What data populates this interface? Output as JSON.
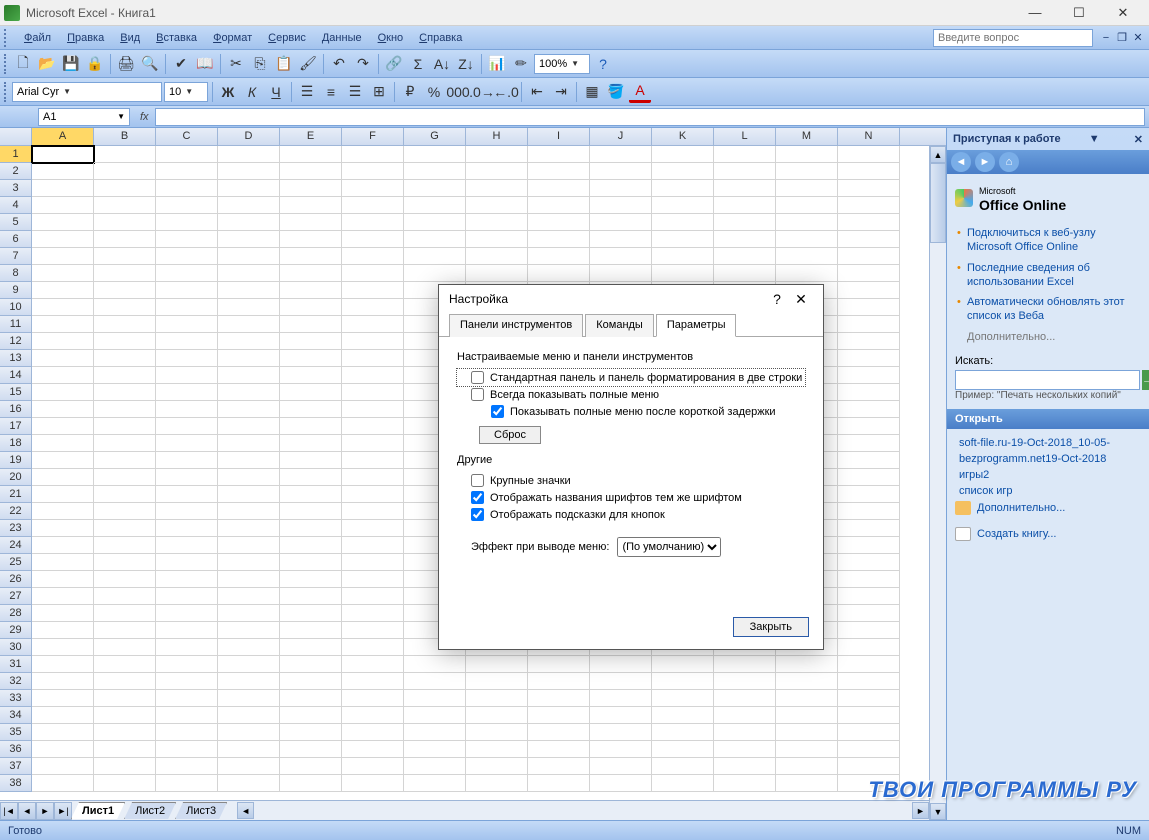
{
  "window": {
    "title": "Microsoft Excel - Книга1"
  },
  "menu": {
    "items": [
      "Файл",
      "Правка",
      "Вид",
      "Вставка",
      "Формат",
      "Сервис",
      "Данные",
      "Окно",
      "Справка"
    ],
    "ask_placeholder": "Введите вопрос"
  },
  "toolbar2": {
    "font": "Arial Cyr",
    "size": "10",
    "zoom": "100%"
  },
  "namebox": "A1",
  "columns": [
    "A",
    "B",
    "C",
    "D",
    "E",
    "F",
    "G",
    "H",
    "I",
    "J",
    "K",
    "L",
    "M",
    "N"
  ],
  "rowcount": 38,
  "active_cell": {
    "row": 1,
    "col": 0
  },
  "sheets": {
    "tabs": [
      "Лист1",
      "Лист2",
      "Лист3"
    ],
    "active": 0
  },
  "taskpane": {
    "title": "Приступая к работе",
    "office_label_1": "Microsoft",
    "office_label_2": "Office Online",
    "links": [
      "Подключиться к веб-узлу Microsoft Office Online",
      "Последние сведения об использовании Excel",
      "Автоматически обновлять этот список из Веба"
    ],
    "more": "Дополнительно...",
    "search_label": "Искать:",
    "example": "Пример: \"Печать нескольких копий\"",
    "open_header": "Открыть",
    "files": [
      "soft-file.ru-19-Oct-2018_10-05-",
      "bezprogramm.net19-Oct-2018",
      "игры2",
      "список игр"
    ],
    "more_files": "Дополнительно...",
    "create": "Создать книгу..."
  },
  "dialog": {
    "title": "Настройка",
    "tabs": [
      "Панели инструментов",
      "Команды",
      "Параметры"
    ],
    "active_tab": 2,
    "group1_label": "Настраиваемые меню и панели инструментов",
    "chk_two_rows": "Стандартная панель и панель форматирования в две строки",
    "chk_full_menus": "Всегда показывать полные меню",
    "chk_after_delay": "Показывать полные меню после короткой задержки",
    "reset_btn": "Сброс",
    "group2_label": "Другие",
    "chk_large_icons": "Крупные значки",
    "chk_font_names": "Отображать названия шрифтов тем же шрифтом",
    "chk_tooltips": "Отображать подсказки для кнопок",
    "effect_label": "Эффект при выводе меню:",
    "effect_value": "(По умолчанию)",
    "close_btn": "Закрыть"
  },
  "statusbar": {
    "ready": "Готово",
    "num": "NUM"
  },
  "watermark": "ТВОИ ПРОГРАММЫ РУ"
}
